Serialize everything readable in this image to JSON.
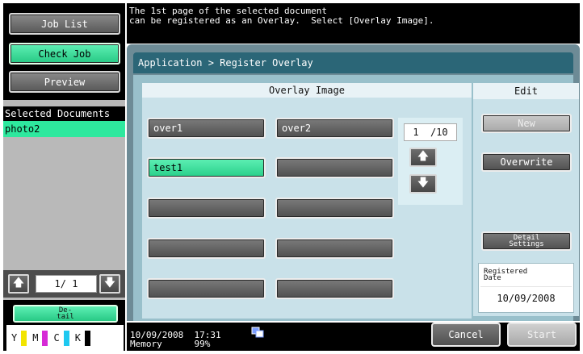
{
  "sidebar": {
    "job_list": "Job List",
    "check_job": "Check Job",
    "preview": "Preview",
    "selected_documents_title": "Selected Documents",
    "selected_documents": [
      "photo2"
    ],
    "page_indicator": "1/ 1",
    "detail_label": "De-\ntail",
    "toner": [
      {
        "label": "Y",
        "color": "#f2e400"
      },
      {
        "label": "M",
        "color": "#d62ad6"
      },
      {
        "label": "C",
        "color": "#1ec8f0"
      },
      {
        "label": "K",
        "color": "#000000"
      }
    ]
  },
  "message": {
    "text": "The 1st page of the selected document\ncan be registered as an Overlay.  Select [Overlay Image]."
  },
  "breadcrumb": "Application > Register Overlay",
  "overlay": {
    "header": "Overlay Image",
    "items": [
      {
        "label": "over1",
        "selected": false
      },
      {
        "label": "over2",
        "selected": false
      },
      {
        "label": "test1",
        "selected": true
      },
      {
        "label": "",
        "selected": false
      },
      {
        "label": "",
        "selected": false
      },
      {
        "label": "",
        "selected": false
      },
      {
        "label": "",
        "selected": false
      },
      {
        "label": "",
        "selected": false
      },
      {
        "label": "",
        "selected": false
      },
      {
        "label": "",
        "selected": false
      }
    ],
    "page": "1  /10"
  },
  "edit": {
    "header": "Edit",
    "new_label": "New",
    "overwrite_label": "Overwrite",
    "detail_settings_label": "Detail\nSettings",
    "registered_date_label": "Registered\nDate",
    "registered_date": "10/09/2008"
  },
  "footer": {
    "date": "10/09/2008",
    "time": "17:31",
    "memory_label": "Memory",
    "memory_value": "99%",
    "cancel": "Cancel",
    "start": "Start"
  },
  "colors": {
    "accent_green": "#2ee89e",
    "header_teal": "#2b6677"
  }
}
